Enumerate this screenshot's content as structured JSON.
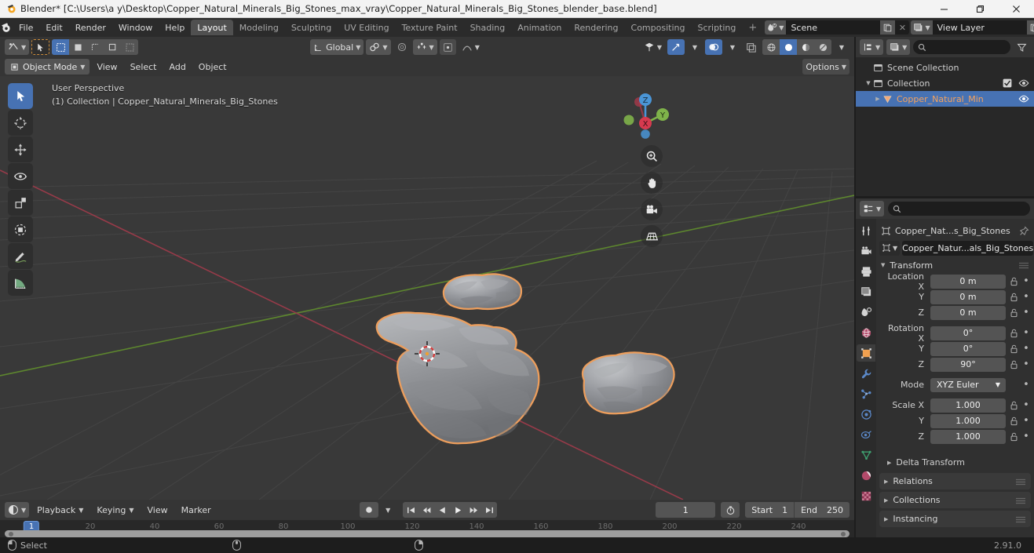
{
  "window": {
    "title": "Blender* [C:\\Users\\a y\\Desktop\\Copper_Natural_Minerals_Big_Stones_max_vray\\Copper_Natural_Minerals_Big_Stones_blender_base.blend]",
    "minimize": "—",
    "maximize": "❐",
    "close": "✕"
  },
  "topbar": {
    "menus": [
      "File",
      "Edit",
      "Render",
      "Window",
      "Help"
    ],
    "workspaces": [
      {
        "label": "Layout",
        "active": true
      },
      {
        "label": "Modeling",
        "active": false
      },
      {
        "label": "Sculpting",
        "active": false
      },
      {
        "label": "UV Editing",
        "active": false
      },
      {
        "label": "Texture Paint",
        "active": false
      },
      {
        "label": "Shading",
        "active": false
      },
      {
        "label": "Animation",
        "active": false
      },
      {
        "label": "Rendering",
        "active": false
      },
      {
        "label": "Compositing",
        "active": false
      },
      {
        "label": "Scripting",
        "active": false
      }
    ],
    "add_workspace": "+",
    "scene_name": "Scene",
    "view_layer_name": "View Layer"
  },
  "viewport_header": {
    "transform_orientation": "Global",
    "options_label": "Options"
  },
  "viewport_tools": {
    "mode": "Object Mode",
    "menus": [
      "View",
      "Select",
      "Add",
      "Object"
    ]
  },
  "viewport": {
    "perspective_label": "User Perspective",
    "collection_label": "(1) Collection | Copper_Natural_Minerals_Big_Stones",
    "background_color": "#393939",
    "grid_color": "#4a4a4a",
    "x_axis_color": "#9e4756",
    "y_axis_color": "#5a7c28",
    "object_color": "#8e9094",
    "selection_outline_color": "#ed9e5c",
    "gizmo": {
      "x": "X",
      "y": "Y",
      "z": "Z"
    },
    "tools": [
      "tweak-select-tool",
      "cursor-tool",
      "move-tool",
      "rotate-tool",
      "scale-tool",
      "transform-tool",
      "annotate-tool",
      "measure-tool"
    ],
    "nav_buttons": [
      "zoom-tool",
      "pan-tool",
      "camera-view-tool",
      "toggle-perspective-tool"
    ]
  },
  "outliner": {
    "search_placeholder": "",
    "rows": [
      {
        "label": "Scene Collection",
        "icon": "collection-icon",
        "indent": 0,
        "selected": false,
        "disclosure": "",
        "checkbox": false,
        "eye": false
      },
      {
        "label": "Collection",
        "icon": "collection-icon",
        "indent": 1,
        "selected": false,
        "disclosure": "▼",
        "checkbox": true,
        "eye": true
      },
      {
        "label": "Copper_Natural_Min",
        "icon": "mesh-object-icon",
        "indent": 2,
        "selected": true,
        "disclosure": "▶",
        "checkbox": false,
        "eye": true
      }
    ]
  },
  "properties": {
    "search_placeholder": "",
    "breadcrumb": "Copper_Nat...s_Big_Stones",
    "object_name": "Copper_Natur...als_Big_Stones",
    "panels": [
      {
        "label": "Transform",
        "open": true
      },
      {
        "label": "Delta Transform",
        "open": false,
        "sub": true
      },
      {
        "label": "Relations",
        "open": false
      },
      {
        "label": "Collections",
        "open": false
      },
      {
        "label": "Instancing",
        "open": false
      }
    ],
    "transform": {
      "location": [
        {
          "label": "Location X",
          "value": "0 m"
        },
        {
          "label": "Y",
          "value": "0 m"
        },
        {
          "label": "Z",
          "value": "0 m"
        }
      ],
      "rotation": [
        {
          "label": "Rotation X",
          "value": "0°"
        },
        {
          "label": "Y",
          "value": "0°"
        },
        {
          "label": "Z",
          "value": "90°"
        }
      ],
      "mode": {
        "label": "Mode",
        "value": "XYZ Euler"
      },
      "scale": [
        {
          "label": "Scale X",
          "value": "1.000"
        },
        {
          "label": "Y",
          "value": "1.000"
        },
        {
          "label": "Z",
          "value": "1.000"
        }
      ]
    },
    "tabs": [
      "tool-icon",
      "render-icon",
      "output-icon",
      "view-layer-icon",
      "scene-icon",
      "world-icon",
      "object-icon",
      "modifier-icon",
      "particles-icon",
      "physics-icon",
      "constraints-icon",
      "data-icon",
      "material-icon",
      "texture-icon"
    ]
  },
  "timeline": {
    "menus": [
      "Playback",
      "Keying",
      "View",
      "Marker"
    ],
    "current_frame": "1",
    "start_label": "Start",
    "start_value": "1",
    "end_label": "End",
    "end_value": "250",
    "ticks": [
      "20",
      "40",
      "60",
      "80",
      "100",
      "120",
      "140",
      "160",
      "180",
      "200",
      "220",
      "240"
    ],
    "playhead_label": "1",
    "accent_color": "#4772b3"
  },
  "statusbar": {
    "select_label": "Select",
    "version": "2.91.0"
  }
}
